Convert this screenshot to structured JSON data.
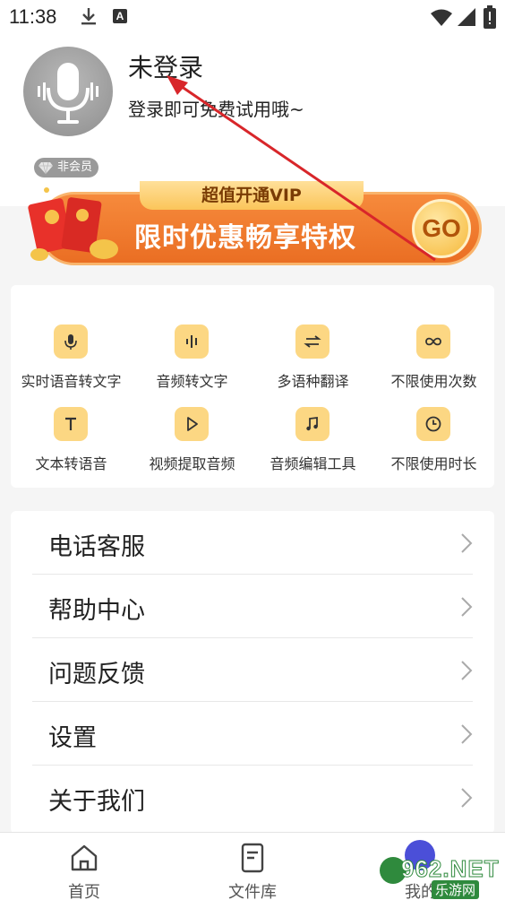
{
  "status_bar": {
    "time": "11:38"
  },
  "profile": {
    "title": "未登录",
    "subtitle": "登录即可免费试用哦~",
    "badge": "非会员"
  },
  "vip_banner": {
    "tab": "超值开通VIP",
    "headline": "限时优惠畅享特权",
    "go_label": "GO"
  },
  "features": [
    {
      "label": "实时语音转文字",
      "icon": "microphone-icon"
    },
    {
      "label": "音频转文字",
      "icon": "audio-wave-icon"
    },
    {
      "label": "多语种翻译",
      "icon": "translate-icon"
    },
    {
      "label": "不限使用次数",
      "icon": "infinity-icon"
    },
    {
      "label": "文本转语音",
      "icon": "text-icon"
    },
    {
      "label": "视频提取音频",
      "icon": "play-icon"
    },
    {
      "label": "音频编辑工具",
      "icon": "music-note-icon"
    },
    {
      "label": "不限使用时长",
      "icon": "clock-icon"
    }
  ],
  "menu": [
    {
      "label": "电话客服"
    },
    {
      "label": "帮助中心"
    },
    {
      "label": "问题反馈"
    },
    {
      "label": "设置"
    },
    {
      "label": "关于我们"
    }
  ],
  "bottom_nav": [
    {
      "label": "首页",
      "icon": "home-icon"
    },
    {
      "label": "文件库",
      "icon": "document-icon"
    },
    {
      "label": "我的",
      "icon": "profile-icon"
    }
  ],
  "watermark": {
    "text": "962.NET",
    "sub": "乐游网"
  },
  "colors": {
    "accent": "#ea6e23",
    "feature_icon_bg": "#fcd783",
    "nav_active": "#4b4fd8"
  }
}
